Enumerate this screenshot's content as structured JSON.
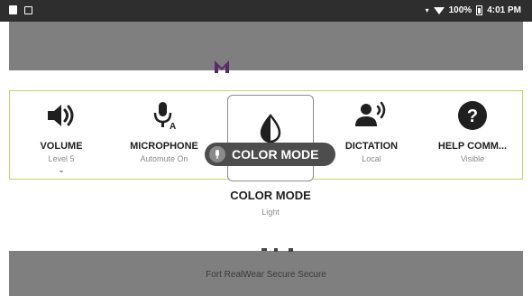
{
  "status_bar": {
    "battery": "100%",
    "time": "4:01 PM"
  },
  "background": {
    "logo": "M",
    "footer": "Fort RealWear Secure Secure"
  },
  "menu": {
    "items": [
      {
        "title": "VOLUME",
        "subtitle": "Level 5",
        "icon": "speaker-icon"
      },
      {
        "title": "MICROPHONE",
        "subtitle": "Automute On",
        "icon": "microphone-icon"
      },
      {
        "title": "COLOR MODE",
        "subtitle": "",
        "icon": "contrast-drop-icon"
      },
      {
        "title": "DICTATION",
        "subtitle": "Local",
        "icon": "speaking-person-icon"
      },
      {
        "title": "HELP COMM...",
        "subtitle": "Visible",
        "icon": "help-icon"
      }
    ],
    "selected": {
      "voice_command": "COLOR MODE",
      "label": "COLOR MODE",
      "value": "Light"
    }
  }
}
